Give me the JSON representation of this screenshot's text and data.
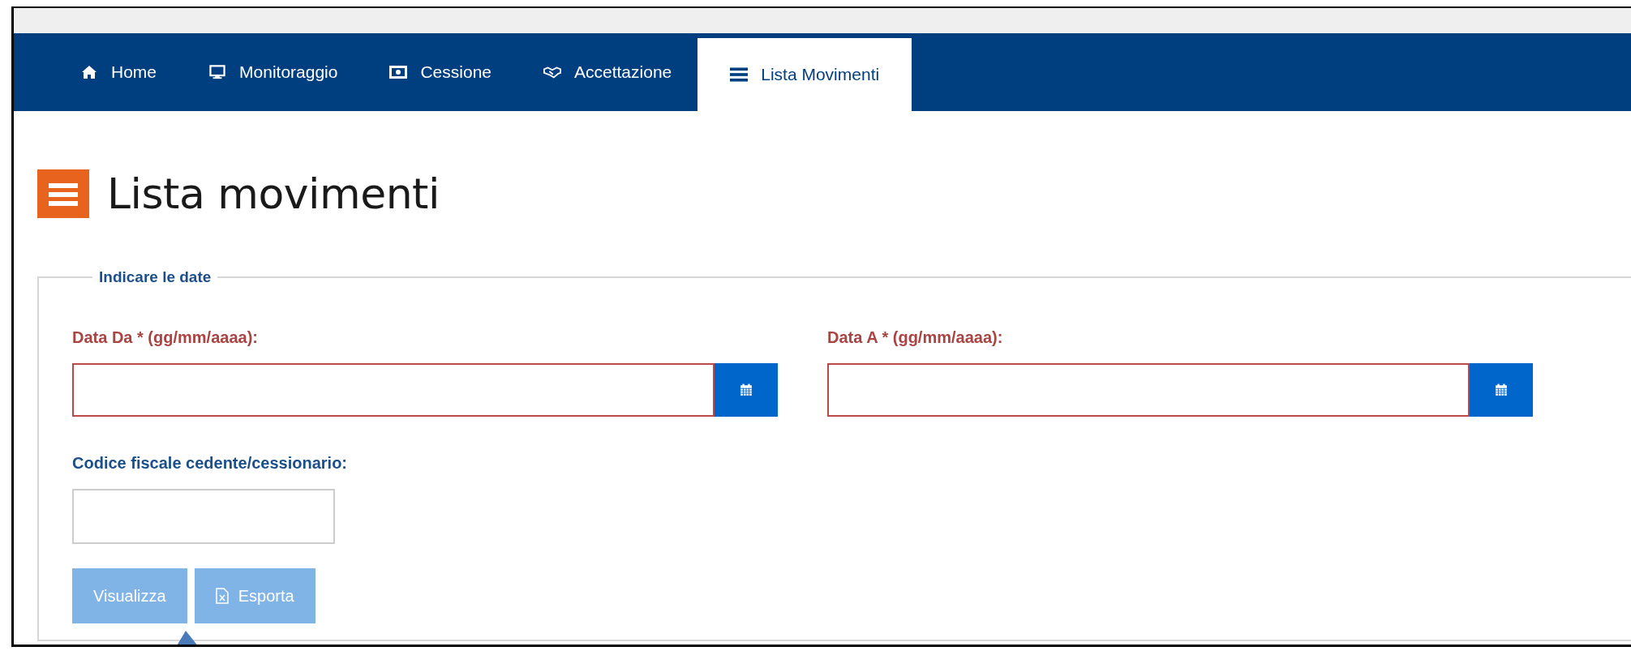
{
  "nav": {
    "tabs": [
      {
        "label": "Home",
        "kind": "home",
        "selected": false
      },
      {
        "label": "Monitoraggio",
        "kind": "monitor",
        "selected": false
      },
      {
        "label": "Cessione",
        "kind": "money",
        "selected": false
      },
      {
        "label": "Accettazione",
        "kind": "handshake",
        "selected": false
      },
      {
        "label": "Lista Movimenti",
        "kind": "list",
        "selected": true
      }
    ]
  },
  "page": {
    "title": "Lista movimenti"
  },
  "form": {
    "legend": "Indicare le date",
    "date_fields": [
      {
        "label": "Data Da * (gg/mm/aaaa):",
        "error": true
      },
      {
        "label": "Data A * (gg/mm/aaaa):",
        "error": true
      }
    ],
    "code_field": {
      "label": "Codice fiscale cedente/cessionario:",
      "error": false
    },
    "buttons": [
      {
        "label": "Visualizza",
        "kind": "plain",
        "disabled": true
      },
      {
        "label": "Esporta",
        "kind": "excel",
        "disabled": true
      }
    ]
  }
}
